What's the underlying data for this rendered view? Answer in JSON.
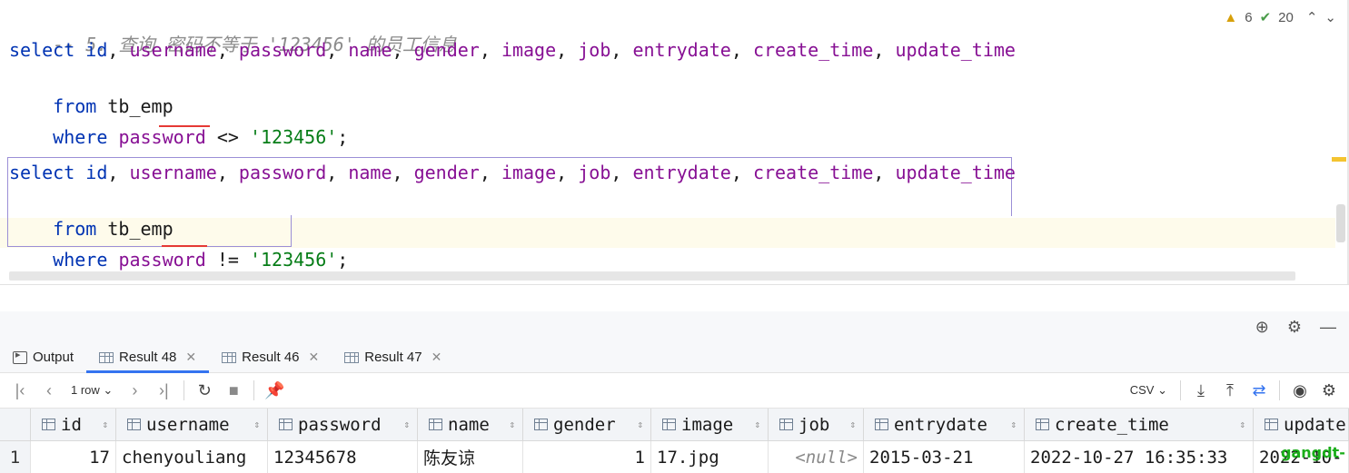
{
  "editor": {
    "comment": "-- 5. 查询 密码不等于 '123456' 的员工信息",
    "query1": {
      "select_kw": "select",
      "columns": [
        "id",
        "username",
        "password",
        "name",
        "gender",
        "image",
        "job",
        "entrydate",
        "create_time",
        "update_time"
      ],
      "from_kw": "from",
      "table": "tb_emp",
      "where_kw": "where",
      "where_col": "password",
      "operator": "<>",
      "value": "'123456'",
      "terminator": ";"
    },
    "query2": {
      "select_kw": "select",
      "columns": [
        "id",
        "username",
        "password",
        "name",
        "gender",
        "image",
        "job",
        "entrydate",
        "create_time",
        "update_time"
      ],
      "from_kw": "from",
      "table": "tb_emp",
      "where_kw": "where",
      "where_col": "password",
      "operator": "!=",
      "value": "'123456'",
      "terminator": ";"
    },
    "inspections": {
      "warnings": "6",
      "ok_count": "20"
    }
  },
  "tabs": [
    {
      "label": "Output",
      "icon": "console-output-icon",
      "closable": false,
      "active": false
    },
    {
      "label": "Result 48",
      "icon": "table-grid-icon",
      "closable": true,
      "active": true
    },
    {
      "label": "Result 46",
      "icon": "table-grid-icon",
      "closable": true,
      "active": false
    },
    {
      "label": "Result 47",
      "icon": "table-grid-icon",
      "closable": true,
      "active": false
    }
  ],
  "result_toolbar": {
    "rows_label": "1 row",
    "export_format": "CSV"
  },
  "table": {
    "columns": [
      "id",
      "username",
      "password",
      "name",
      "gender",
      "image",
      "job",
      "entrydate",
      "create_time",
      "update"
    ],
    "rows": [
      {
        "row_number": "1",
        "cells": [
          "17",
          "chenyouliang",
          "12345678",
          "陈友谅",
          "1",
          "17.jpg",
          "<null>",
          "2015-03-21",
          "2022-10-27 16:35:33",
          "2022-10-"
        ]
      }
    ]
  },
  "watermark": "gangdt-"
}
